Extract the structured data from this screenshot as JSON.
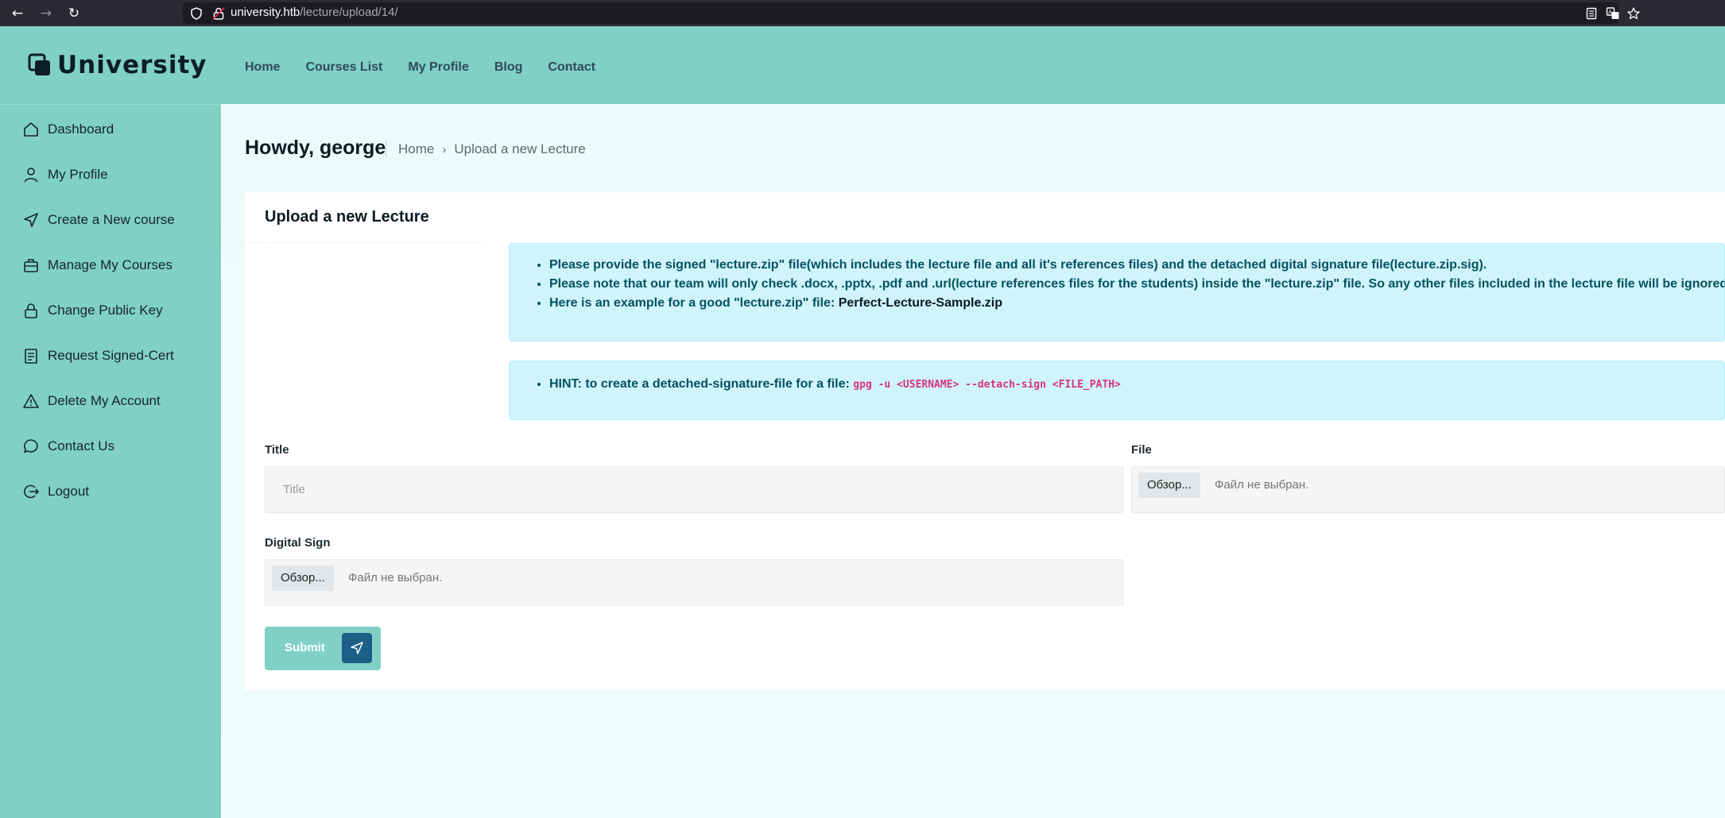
{
  "browser": {
    "url_host": "university.htb",
    "url_path": "/lecture/upload/14/"
  },
  "header": {
    "logo_text": "University",
    "nav": [
      "Home",
      "Courses List",
      "My Profile",
      "Blog",
      "Contact"
    ]
  },
  "sidebar": {
    "items": [
      {
        "label": "Dashboard",
        "icon": "home-icon"
      },
      {
        "label": "My Profile",
        "icon": "user-icon"
      },
      {
        "label": "Create a New course",
        "icon": "send-icon"
      },
      {
        "label": "Manage My Courses",
        "icon": "briefcase-icon"
      },
      {
        "label": "Change Public Key",
        "icon": "lock-icon"
      },
      {
        "label": "Request Signed-Cert",
        "icon": "document-icon"
      },
      {
        "label": "Delete My Account",
        "icon": "warning-icon"
      },
      {
        "label": "Contact Us",
        "icon": "chat-icon"
      },
      {
        "label": "Logout",
        "icon": "logout-icon"
      }
    ]
  },
  "page": {
    "greeting": "Howdy, george",
    "breadcrumb_home": "Home",
    "breadcrumb_current": "Upload a new Lecture"
  },
  "card": {
    "title": "Upload a new Lecture",
    "info_1": "Please provide the signed \"lecture.zip\" file(which includes the lecture file and all it's references files) and the detached digital signature file(lecture.zip.sig).",
    "info_2": "Please note that our team will only check .docx, .pptx, .pdf and .url(lecture references files for the students) inside the \"lecture.zip\" file. So any other files included in the lecture file will be ignored.",
    "info_3_prefix": "Here is an example for a good \"lecture.zip\" file: ",
    "info_3_link": "Perfect-Lecture-Sample.zip",
    "hint_prefix": "HINT: to create a detached-signature-file for a file: ",
    "hint_code": "gpg -u <USERNAME> --detach-sign <FILE_PATH>"
  },
  "form": {
    "title_label": "Title",
    "title_placeholder": "Title",
    "title_value": "",
    "file_label": "File",
    "file_button": "Обзор...",
    "file_status": "Файл не выбран.",
    "sign_label": "Digital Sign",
    "sign_button": "Обзор...",
    "sign_status": "Файл не выбран.",
    "submit_label": "Submit"
  },
  "colors": {
    "accent": "#80d0c7",
    "send_button": "#1d5f86",
    "alert_bg": "#cff4fc",
    "alert_text": "#055160",
    "code_text": "#d63384"
  }
}
